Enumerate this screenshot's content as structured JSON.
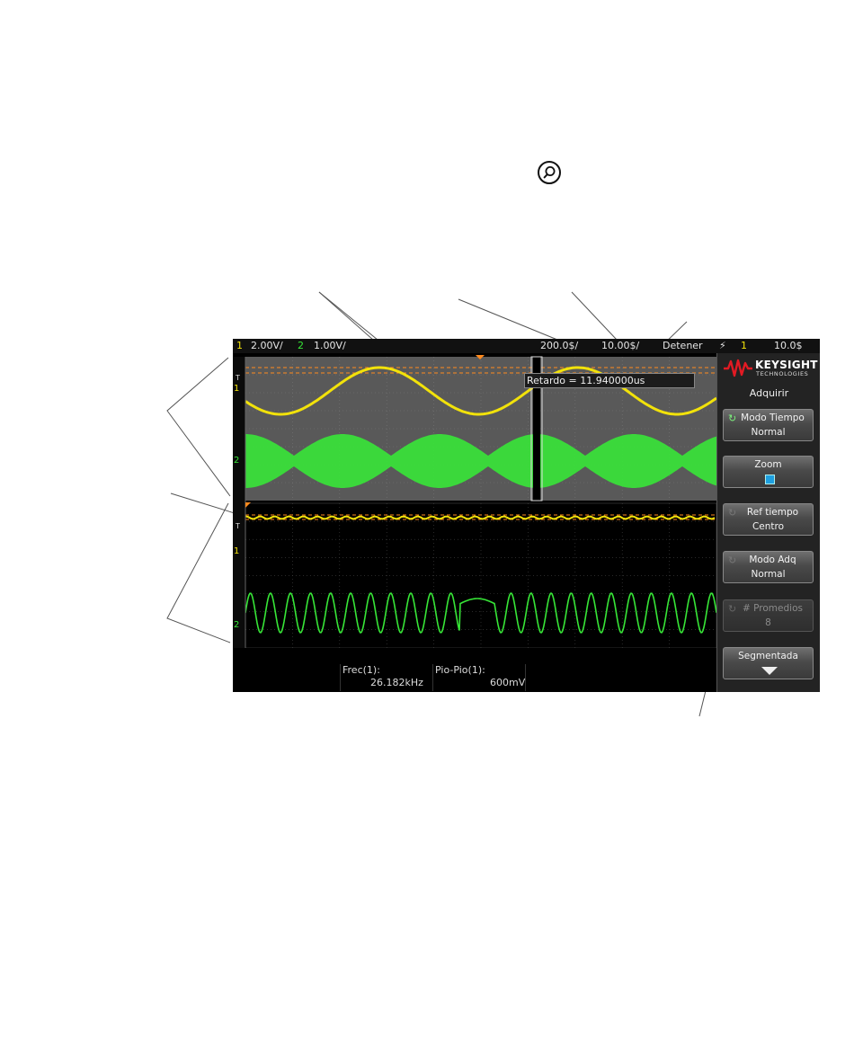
{
  "zoom_key_icon": "magnifier-icon",
  "status_bar": {
    "ch1_num": "1",
    "ch1_scale": "2.00V/",
    "ch2_num": "2",
    "ch2_scale": "1.00V/",
    "zoom_timebase": "200.0$/",
    "main_timebase": "10.00$/",
    "run_state": "Detener",
    "trigger_icon": "trigger-edge-icon",
    "trigger_source": "1",
    "trigger_level": "10.0$"
  },
  "waveform": {
    "delay_label": "Retardo = 11.940000us",
    "ch1_marker": "1",
    "ch2_marker": "2",
    "trigger_marker": "T",
    "colors": {
      "ch1": "#f2e20a",
      "ch2": "#37e637",
      "trigger": "#ff8a1e",
      "grid_bg_upper": "#5a5a5a"
    }
  },
  "measurements": [
    {
      "label": "Frec(1):",
      "value": "26.182kHz"
    },
    {
      "label": "Pio-Pio(1):",
      "value": "600mV"
    }
  ],
  "side_menu": {
    "brand": "KEYSIGHT",
    "brand_sub": "TECHNOLOGIES",
    "title": "Adquirir",
    "softkeys": [
      {
        "l1": "Modo Tiempo",
        "l2": "Normal",
        "enabled": true
      },
      {
        "l1": "Zoom",
        "l2": "",
        "enabled": true,
        "checked": true
      },
      {
        "l1": "Ref tiempo",
        "l2": "Centro",
        "enabled": true
      },
      {
        "l1": "Modo Adq",
        "l2": "Normal",
        "enabled": true
      },
      {
        "l1": "# Promedios",
        "l2": "8",
        "enabled": false
      },
      {
        "l1": "Segmentada",
        "l2": "",
        "enabled": true,
        "icon": "arrow-down-icon"
      }
    ]
  }
}
